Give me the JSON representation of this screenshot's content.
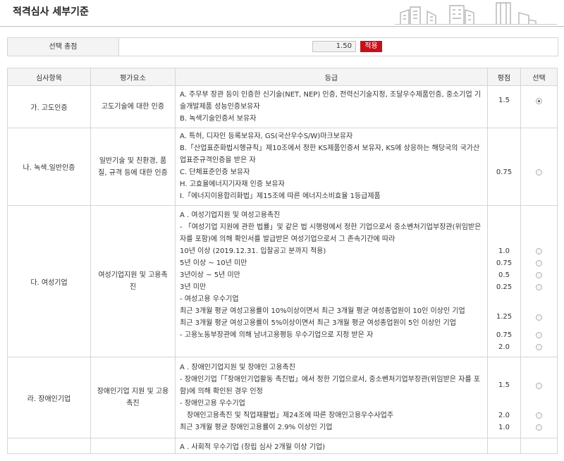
{
  "page": {
    "title": "적격심사 세부기준"
  },
  "total": {
    "label": "선택 총점",
    "value": "1.50",
    "apply_label": "적용"
  },
  "table": {
    "headers": [
      "심사항목",
      "평가요소",
      "등급",
      "평점",
      "선택"
    ],
    "rows": [
      {
        "item": "가. 고도인증",
        "element": "고도기술에 대한 인증",
        "lines": [
          {
            "text": "A. 주무부 장관 등이 인증한 신기술(NET, NEP) 인증, 전력신기술지정, 조달우수제품인증, 중소기업 기술개발제품 성능인증보유자",
            "wrap": true,
            "score": "1.5",
            "radio": "checked"
          },
          {
            "text": "B. 녹색기술인증서 보유자",
            "score": "",
            "radio": "none"
          }
        ]
      },
      {
        "item": "나. 녹색.일반인증",
        "element": "일반기술 및 친환경, 품질, 규격 등에 대한 인증",
        "lines": [
          {
            "text": "A. 특허, 디자인 등록보유자, GS(국산우수S/W)마크보유자",
            "score": "",
            "radio": "none"
          },
          {
            "text": "B.「산업표준화법시행규칙」제10조에서 정한 KS제품인증서 보유자, KS에 상응하는 해당국의 국가산업표준규격인증을 받은 자",
            "wrap": true,
            "score": "",
            "radio": "none"
          },
          {
            "text": "C. 단체표준인증 보유자",
            "score": "0.75",
            "radio": "unchecked"
          },
          {
            "text": "H. 고효율에너지기자재 인증 보유자",
            "score": "",
            "radio": "none"
          },
          {
            "text": "I.「에너지이용합리화법」제15조에 따른 에너지소비효율 1등급제품",
            "score": "",
            "radio": "none"
          }
        ]
      },
      {
        "item": "다. 여성기업",
        "element": "여성기업지원 및 고용촉진",
        "lines": [
          {
            "text": "A . 여성기업지원 및 여성고용촉진",
            "score": "",
            "radio": "none"
          },
          {
            "text": "- 「여성기업 지원에 관한 법률」및 같은 법 시행령에서 정한 기업으로서 중소벤처기업부장관(위임받은 자를 포함)에 의해 확인서를 발급받은 여성기업으로서 그 존속기간에 따라",
            "wrap": true,
            "score": "",
            "radio": "none"
          },
          {
            "text": "10년 이상 (2019.12.31. 입찰공고 분까지 적용)",
            "score": "1.0",
            "radio": "unchecked"
          },
          {
            "text": "5년 이상 ~ 10년 미만",
            "score": "0.75",
            "radio": "unchecked"
          },
          {
            "text": "3년이상 ~ 5년 미만",
            "score": "0.5",
            "radio": "unchecked"
          },
          {
            "text": "3년 미만",
            "score": "0.25",
            "radio": "unchecked"
          },
          {
            "text": "- 여성고용 우수기업",
            "score": "",
            "radio": "none"
          },
          {
            "text": "최근 3개월 평균 여성고용률이 10%이상이면서 최근 3개월 평균 여성종업원이 10인 이상인 기업",
            "wrap": true,
            "score": "1.25",
            "radio": "unchecked"
          },
          {
            "text": "최근 3개월 평균 여성고용률이 5%이상이면서 최근 3개월 평균 여성종업원이 5인 이상인 기업",
            "score": "0.75",
            "radio": "unchecked"
          },
          {
            "text": "- 고용노동부장관에 의해 남녀고용평등 우수기업으로 지정 받은 자",
            "score": "2.0",
            "radio": "unchecked"
          }
        ]
      },
      {
        "item": "라. 장애인기업",
        "element": "장애인기업 지원 및 고용촉진",
        "lines": [
          {
            "text": "A . 장애인기업지원 및 장애인 고용촉진",
            "score": "",
            "radio": "none"
          },
          {
            "text": "- 장애인기업「「장애인기업활동 촉진법」에서 정한 기업으로서, 중소벤처기업부장관(위임받은 자를 포함)에 의해 확인된 경우 인정",
            "wrap": true,
            "score": "1.5",
            "radio": "unchecked"
          },
          {
            "text": "- 장애인고용 우수기업",
            "score": "",
            "radio": "none"
          },
          {
            "text": "　장애인고용촉진 및 직업재활법」제24조에 따른 장애인고용우수사업주",
            "score": "2.0",
            "radio": "unchecked"
          },
          {
            "text": "최근 3개월 평균 장애인고용률이 2.9% 이상인 기업",
            "score": "1.0",
            "radio": "unchecked"
          }
        ]
      },
      {
        "item": "",
        "element": "",
        "lines": [
          {
            "text": "A . 사회적 우수기업 (창립 심사 2개월 이상 기업)",
            "score": "",
            "radio": "none"
          }
        ]
      }
    ]
  }
}
